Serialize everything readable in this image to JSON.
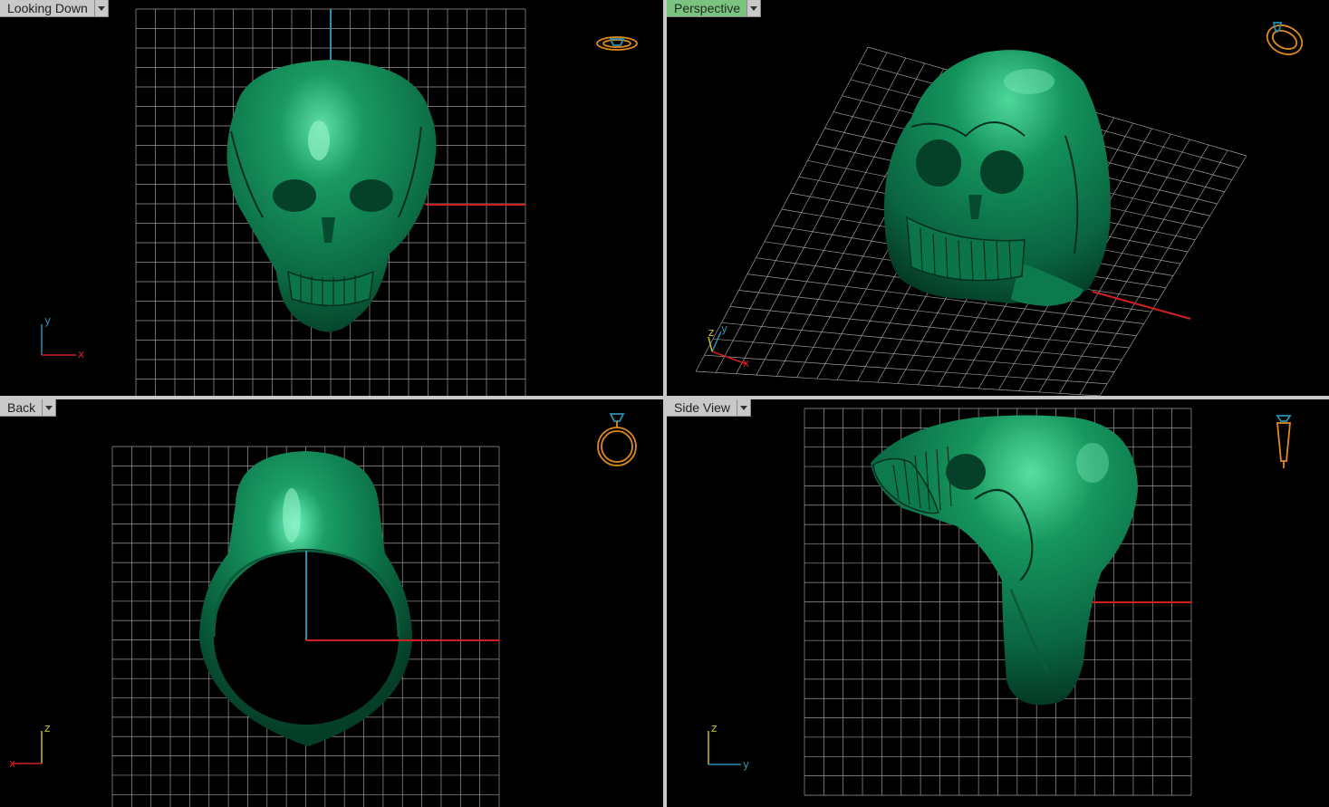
{
  "viewports": {
    "top_left": {
      "label": "Looking Down",
      "axis_h": "x",
      "axis_v": "y"
    },
    "top_right": {
      "label": "Perspective",
      "axis_h": "x",
      "axis_v": "y",
      "axis_z": "z"
    },
    "bottom_left": {
      "label": "Back",
      "axis_h": "x",
      "axis_v": "z"
    },
    "bottom_right": {
      "label": "Side View",
      "axis_h": "y",
      "axis_v": "z"
    }
  },
  "colors": {
    "background": "#000000",
    "grid": "#9a9a9a",
    "model": "#0f7a4f",
    "x_axis": "#d02020",
    "y_axis": "#2a8fb0",
    "gizmo": "#e08a1e",
    "active_tab": "#7bc47f",
    "tab": "#c9c9c9"
  },
  "icons": {
    "top_left": "ring-top-icon",
    "top_right": "ring-perspective-icon",
    "bottom_left": "ring-front-icon",
    "bottom_right": "ring-side-icon"
  }
}
